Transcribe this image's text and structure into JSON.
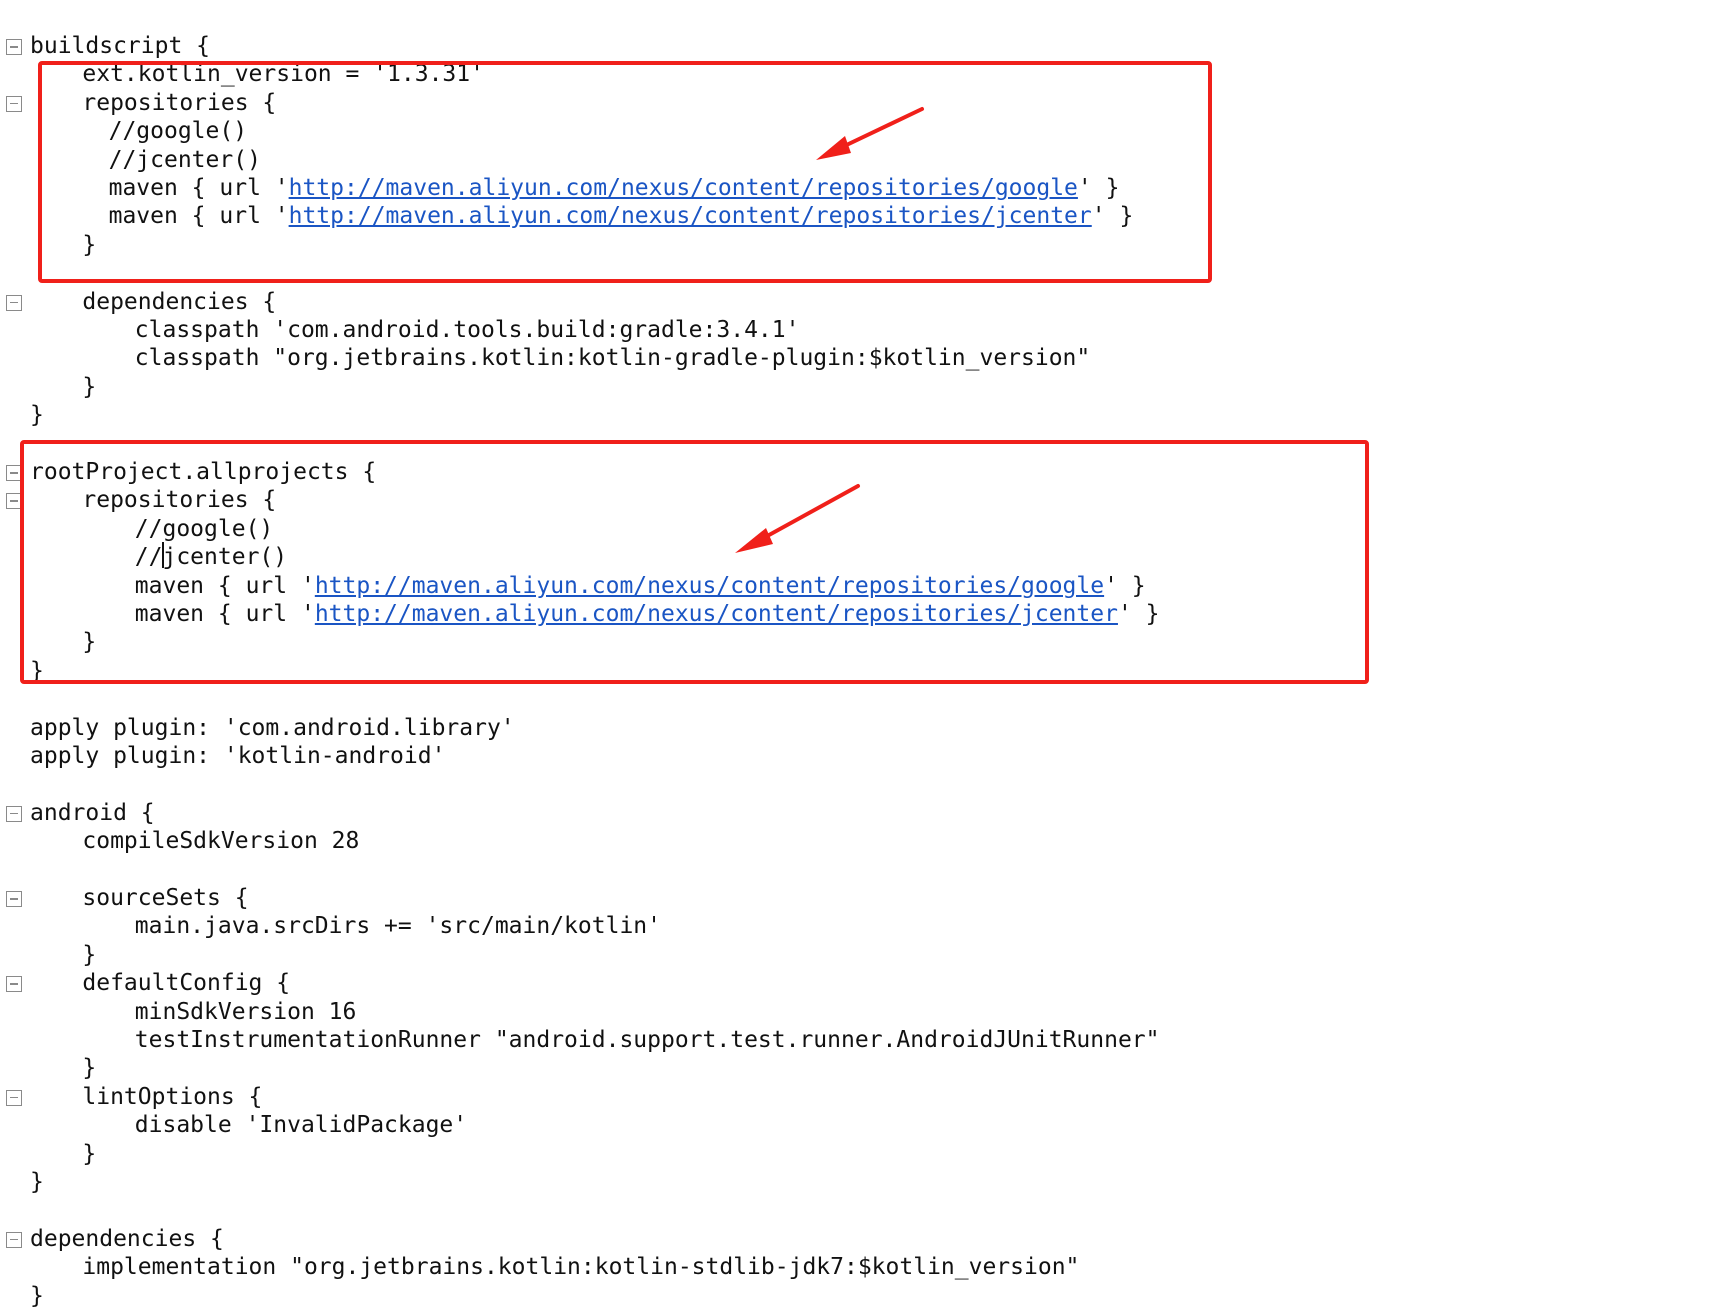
{
  "editor": {
    "colors": {
      "text": "#111111",
      "link": "#1a55c4",
      "highlight": "#f0201a",
      "fold_marker": "#8a8a8a"
    },
    "lines": [
      {
        "indent": 0,
        "fold": true,
        "parts": [
          {
            "t": "buildscript {"
          }
        ]
      },
      {
        "indent": 4,
        "parts": [
          {
            "t": "ext.kotlin_version = '1.3.31'"
          }
        ]
      },
      {
        "indent": 4,
        "fold": true,
        "parts": [
          {
            "t": "repositories {"
          }
        ]
      },
      {
        "indent": 6,
        "parts": [
          {
            "t": "//google()"
          }
        ]
      },
      {
        "indent": 6,
        "parts": [
          {
            "t": "//jcenter()"
          }
        ]
      },
      {
        "indent": 6,
        "parts": [
          {
            "t": "maven { url '"
          },
          {
            "t": "http://maven.aliyun.com/nexus/content/repositories/google",
            "link": true
          },
          {
            "t": "' }"
          }
        ]
      },
      {
        "indent": 6,
        "parts": [
          {
            "t": "maven { url '"
          },
          {
            "t": "http://maven.aliyun.com/nexus/content/repositories/jcenter",
            "link": true
          },
          {
            "t": "' }"
          }
        ]
      },
      {
        "indent": 4,
        "parts": [
          {
            "t": "}"
          }
        ]
      },
      {
        "indent": 0,
        "parts": []
      },
      {
        "indent": 4,
        "fold": true,
        "parts": [
          {
            "t": "dependencies {"
          }
        ]
      },
      {
        "indent": 8,
        "parts": [
          {
            "t": "classpath 'com.android.tools.build:gradle:3.4.1'"
          }
        ]
      },
      {
        "indent": 8,
        "parts": [
          {
            "t": "classpath \"org.jetbrains.kotlin:kotlin-gradle-plugin:$kotlin_version\""
          }
        ]
      },
      {
        "indent": 4,
        "parts": [
          {
            "t": "}"
          }
        ]
      },
      {
        "indent": 0,
        "parts": [
          {
            "t": "}"
          }
        ]
      },
      {
        "indent": 0,
        "parts": []
      },
      {
        "indent": 0,
        "fold": true,
        "parts": [
          {
            "t": "rootProject.allprojects {"
          }
        ]
      },
      {
        "indent": 4,
        "fold": true,
        "parts": [
          {
            "t": "repositories {"
          }
        ]
      },
      {
        "indent": 8,
        "parts": [
          {
            "t": "//google()"
          }
        ]
      },
      {
        "indent": 8,
        "parts": [
          {
            "t": "//jcenter()"
          }
        ]
      },
      {
        "indent": 8,
        "parts": [
          {
            "t": "maven { url '"
          },
          {
            "t": "http://maven.aliyun.com/nexus/content/repositories/google",
            "link": true
          },
          {
            "t": "' }"
          }
        ]
      },
      {
        "indent": 8,
        "parts": [
          {
            "t": "maven { url '"
          },
          {
            "t": "http://maven.aliyun.com/nexus/content/repositories/jcenter",
            "link": true
          },
          {
            "t": "' }"
          }
        ]
      },
      {
        "indent": 4,
        "parts": [
          {
            "t": "}"
          }
        ]
      },
      {
        "indent": 0,
        "parts": [
          {
            "t": "}"
          }
        ]
      },
      {
        "indent": 0,
        "parts": []
      },
      {
        "indent": 0,
        "parts": [
          {
            "t": "apply plugin: 'com.android.library'"
          }
        ]
      },
      {
        "indent": 0,
        "parts": [
          {
            "t": "apply plugin: 'kotlin-android'"
          }
        ]
      },
      {
        "indent": 0,
        "parts": []
      },
      {
        "indent": 0,
        "fold": true,
        "parts": [
          {
            "t": "android {"
          }
        ]
      },
      {
        "indent": 4,
        "parts": [
          {
            "t": "compileSdkVersion 28"
          }
        ]
      },
      {
        "indent": 0,
        "parts": []
      },
      {
        "indent": 4,
        "fold": true,
        "parts": [
          {
            "t": "sourceSets {"
          }
        ]
      },
      {
        "indent": 8,
        "parts": [
          {
            "t": "main.java.srcDirs += 'src/main/kotlin'"
          }
        ]
      },
      {
        "indent": 4,
        "parts": [
          {
            "t": "}"
          }
        ]
      },
      {
        "indent": 4,
        "fold": true,
        "parts": [
          {
            "t": "defaultConfig {"
          }
        ]
      },
      {
        "indent": 8,
        "parts": [
          {
            "t": "minSdkVersion 16"
          }
        ]
      },
      {
        "indent": 8,
        "parts": [
          {
            "t": "testInstrumentationRunner \"android.support.test.runner.AndroidJUnitRunner\""
          }
        ]
      },
      {
        "indent": 4,
        "parts": [
          {
            "t": "}"
          }
        ]
      },
      {
        "indent": 4,
        "fold": true,
        "parts": [
          {
            "t": "lintOptions {"
          }
        ]
      },
      {
        "indent": 8,
        "parts": [
          {
            "t": "disable 'InvalidPackage'"
          }
        ]
      },
      {
        "indent": 4,
        "parts": [
          {
            "t": "}"
          }
        ]
      },
      {
        "indent": 0,
        "parts": [
          {
            "t": "}"
          }
        ]
      },
      {
        "indent": 0,
        "parts": []
      },
      {
        "indent": 0,
        "fold": true,
        "parts": [
          {
            "t": "dependencies {"
          }
        ]
      },
      {
        "indent": 4,
        "parts": [
          {
            "t": "implementation \"org.jetbrains.kotlin:kotlin-stdlib-jdk7:$kotlin_version\""
          }
        ]
      },
      {
        "indent": 0,
        "parts": [
          {
            "t": "}"
          }
        ]
      }
    ]
  }
}
